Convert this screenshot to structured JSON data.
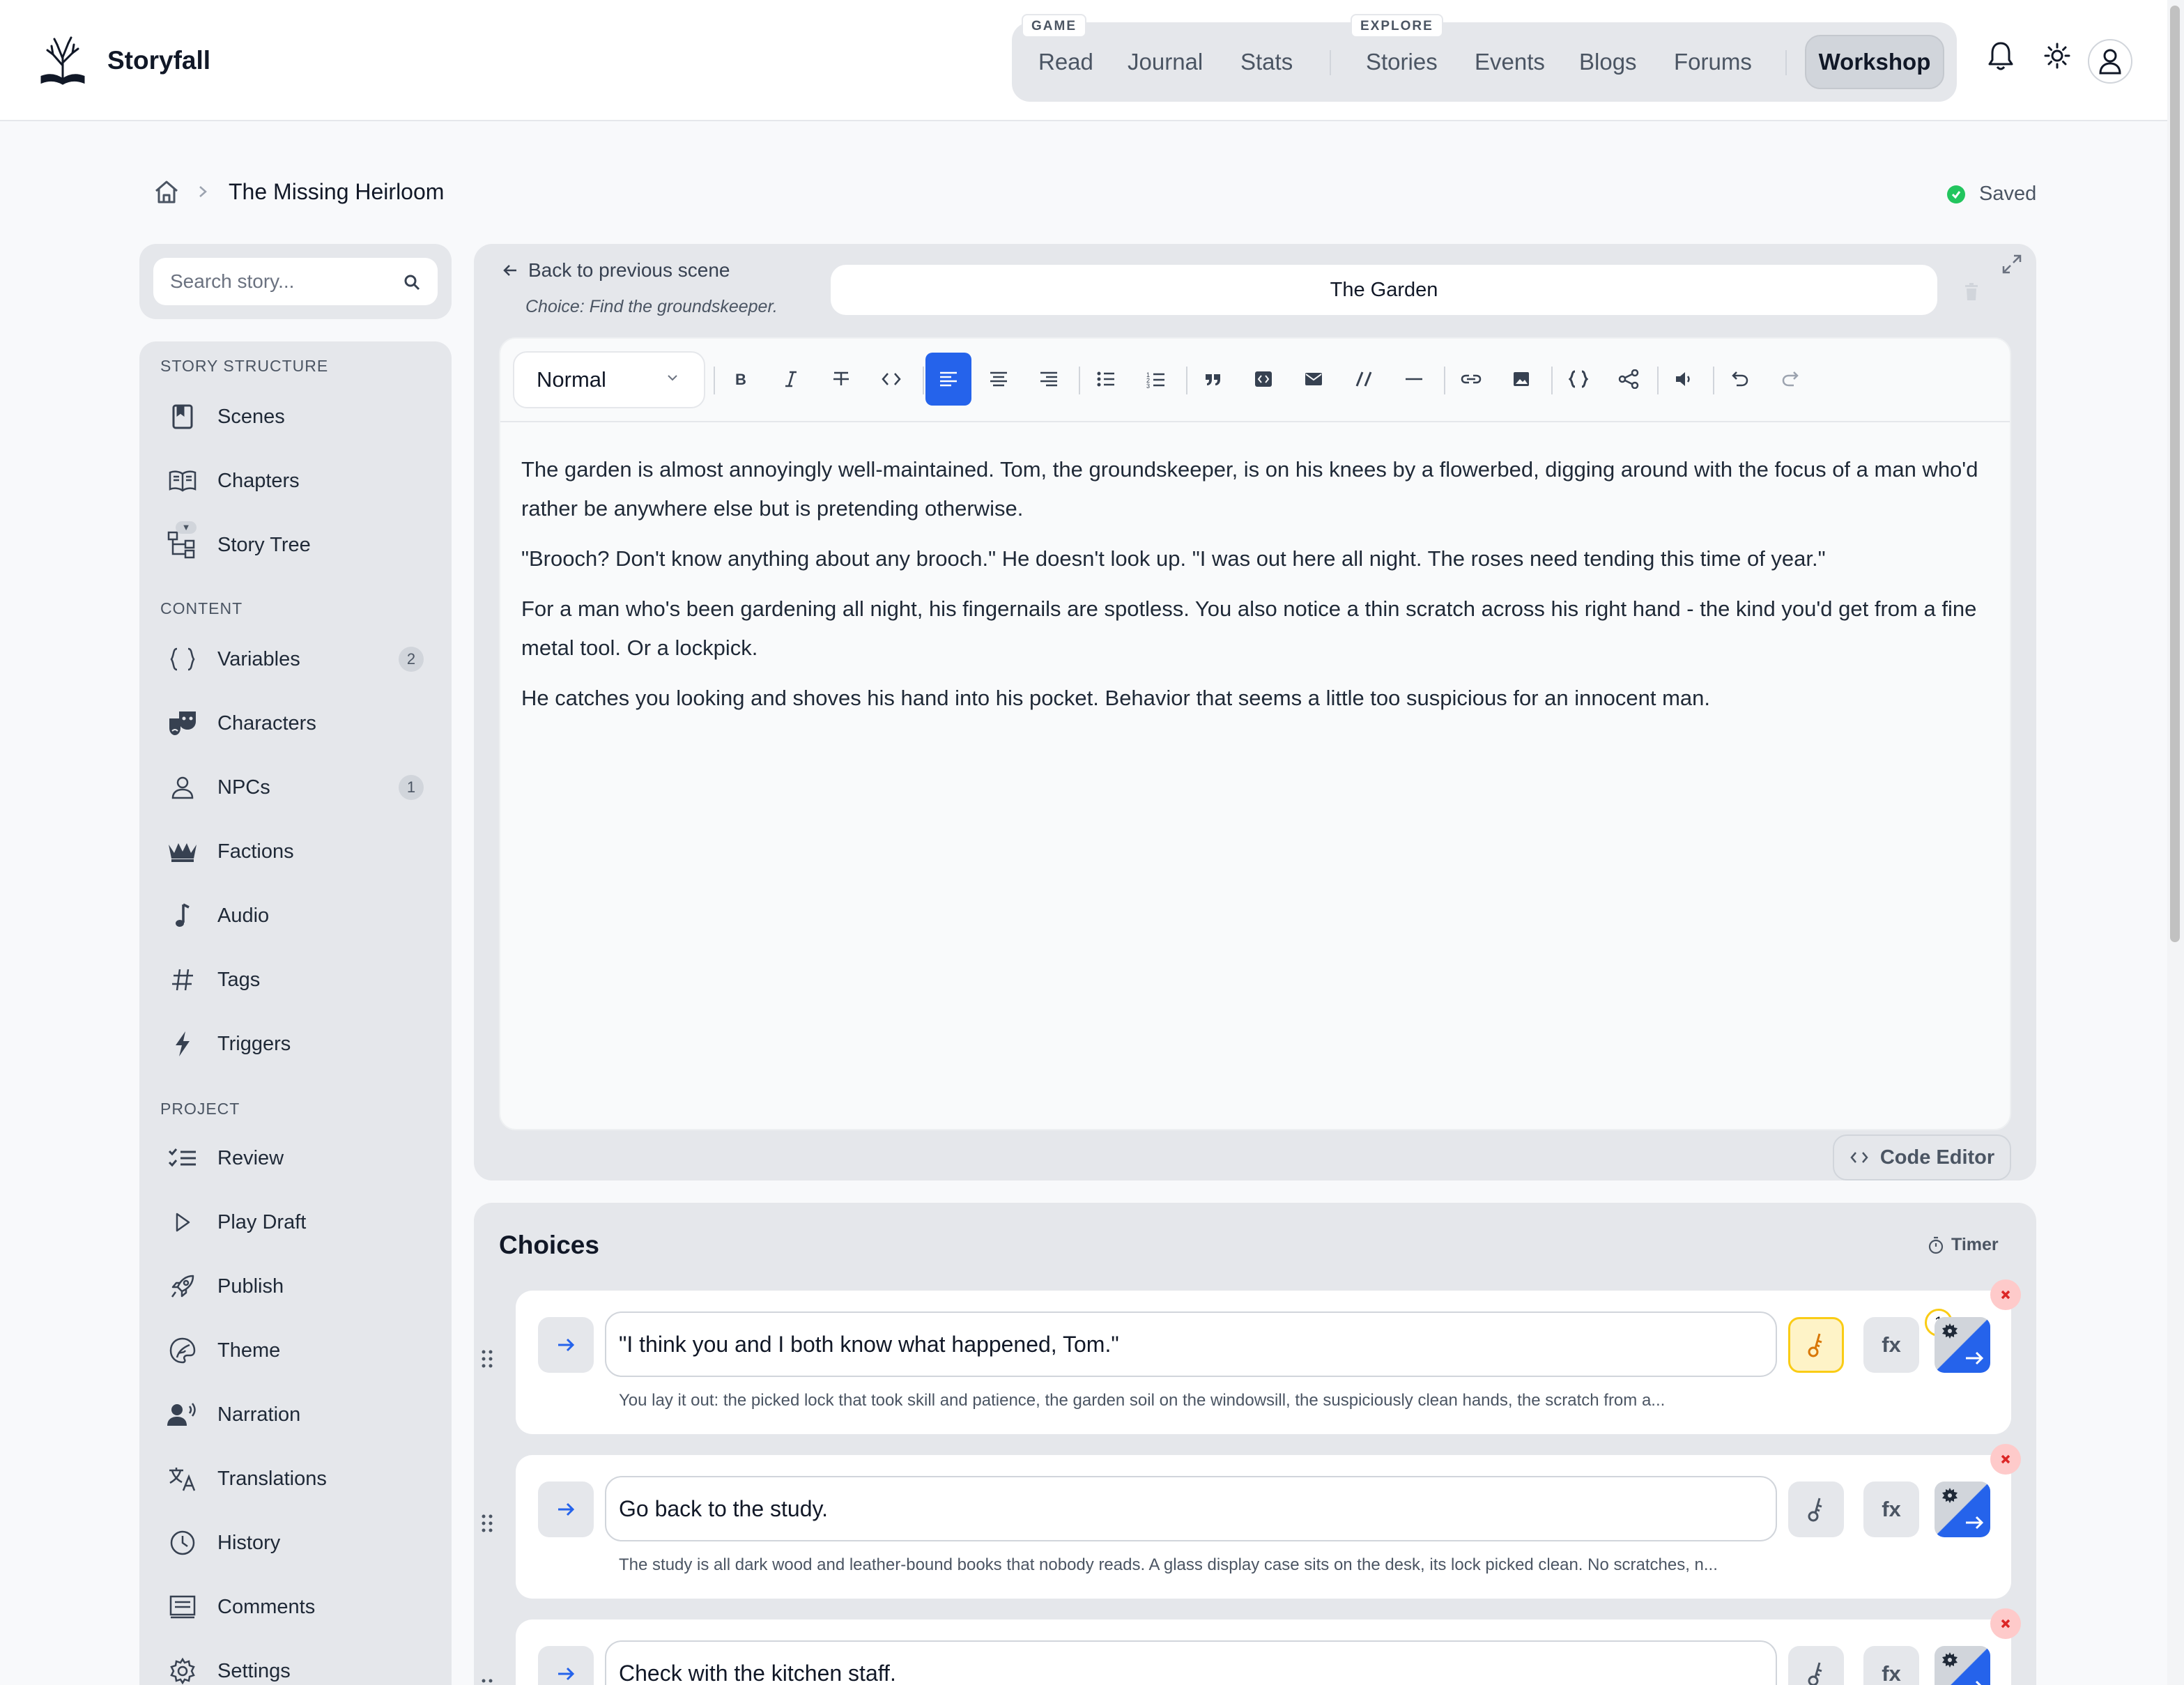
{
  "app": {
    "name": "Storyfall",
    "nav": {
      "group_game": "GAME",
      "group_explore": "EXPLORE",
      "read": "Read",
      "journal": "Journal",
      "stats": "Stats",
      "stories": "Stories",
      "events": "Events",
      "blogs": "Blogs",
      "forums": "Forums",
      "workshop": "Workshop"
    }
  },
  "breadcrumb": {
    "title": "The Missing Heirloom"
  },
  "status": {
    "saved": "Saved",
    "color": "#22c55e"
  },
  "search": {
    "placeholder": "Search story..."
  },
  "sidebar": {
    "sections": {
      "structure": "STORY STRUCTURE",
      "content": "CONTENT",
      "project": "PROJECT"
    },
    "items": [
      {
        "label": "Scenes",
        "icon": "scenes-icon"
      },
      {
        "label": "Chapters",
        "icon": "book-open-icon"
      },
      {
        "label": "Story Tree",
        "icon": "tree-icon"
      },
      {
        "label": "Variables",
        "icon": "braces-icon",
        "badge": "2"
      },
      {
        "label": "Characters",
        "icon": "theater-masks-icon"
      },
      {
        "label": "NPCs",
        "icon": "person-icon",
        "badge": "1"
      },
      {
        "label": "Factions",
        "icon": "crown-icon"
      },
      {
        "label": "Audio",
        "icon": "music-note-icon"
      },
      {
        "label": "Tags",
        "icon": "hash-icon"
      },
      {
        "label": "Triggers",
        "icon": "lightning-icon"
      },
      {
        "label": "Review",
        "icon": "checklist-icon"
      },
      {
        "label": "Play Draft",
        "icon": "play-icon"
      },
      {
        "label": "Publish",
        "icon": "rocket-icon"
      },
      {
        "label": "Theme",
        "icon": "palette-icon"
      },
      {
        "label": "Narration",
        "icon": "speaker-person-icon"
      },
      {
        "label": "Translations",
        "icon": "translate-icon"
      },
      {
        "label": "History",
        "icon": "clock-icon"
      },
      {
        "label": "Comments",
        "icon": "comment-icon"
      },
      {
        "label": "Settings",
        "icon": "gear-icon"
      }
    ]
  },
  "editor": {
    "back_label": "Back to previous scene",
    "choice_hint": "Choice: Find the groundskeeper.",
    "scene_title": "The Garden",
    "format": "Normal",
    "code_editor_label": "Code Editor",
    "paragraphs": [
      "The garden is almost annoyingly well-maintained. Tom, the groundskeeper, is on his knees by a flowerbed, digging around with the focus of a man who'd rather be anywhere else but is pretending otherwise.",
      "\"Brooch? Don't know anything about any brooch.\" He doesn't look up. \"I was out here all night. The roses need tending this time of year.\"",
      "For a man who's been gardening all night, his fingernails are spotless. You also notice a thin scratch across his right hand - the kind you'd get from a fine metal tool. Or a lockpick.",
      "He catches you looking and shoves his hand into his pocket. Behavior that seems a little too suspicious for an innocent man."
    ],
    "accent": "#2563eb"
  },
  "choices": {
    "title": "Choices",
    "timer_label": "Timer",
    "fx_label": "fx",
    "items": [
      {
        "text": "\"I think you and I both know what happened, Tom.\"",
        "desc": "You lay it out: the picked lock that took skill and patience, the garden soil on the windowsill, the suspiciously clean hands, the scratch from a...",
        "key_count": "1"
      },
      {
        "text": "Go back to the study.",
        "desc": "The study is all dark wood and leather-bound books that nobody reads. A glass display case sits on the desk, its lock picked clean. No scratches, n..."
      },
      {
        "text": "Check with the kitchen staff.",
        "desc": ""
      }
    ]
  }
}
